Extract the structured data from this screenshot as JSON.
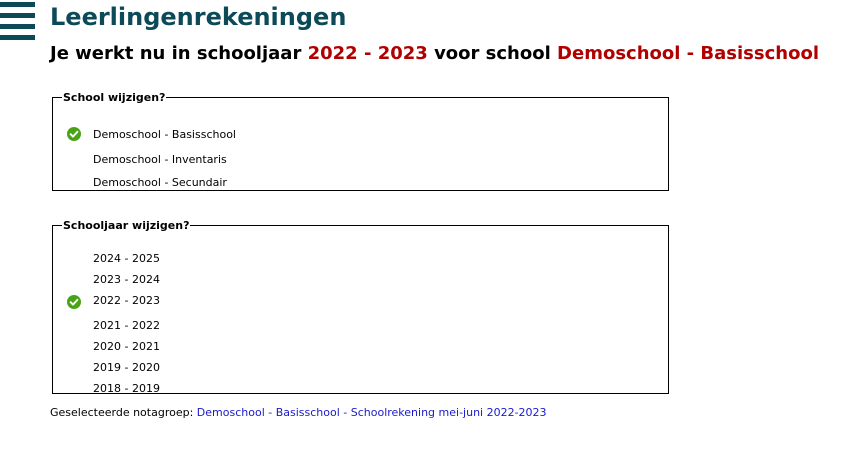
{
  "header": {
    "title": "Leerlingenrekeningen",
    "context_prefix": "Je werkt nu in schooljaar ",
    "context_year": "2022 - 2023",
    "context_middle": " voor school ",
    "context_school": "Demoschool - Basisschool",
    "accent_color": "#b00000",
    "brand_color": "#0d4a57"
  },
  "menu": {
    "icon": "hamburger-menu-icon"
  },
  "school_section": {
    "legend": "School wijzigen?",
    "options": [
      {
        "label": "Demoschool - Basisschool",
        "selected": true
      },
      {
        "label": "Demoschool - Inventaris",
        "selected": false
      },
      {
        "label": "Demoschool - Secundair",
        "selected": false
      }
    ]
  },
  "year_section": {
    "legend": "Schooljaar wijzigen?",
    "options": [
      {
        "label": "2024 - 2025",
        "selected": false
      },
      {
        "label": "2023 - 2024",
        "selected": false
      },
      {
        "label": "2022 - 2023",
        "selected": true
      },
      {
        "label": "2021 - 2022",
        "selected": false
      },
      {
        "label": "2020 - 2021",
        "selected": false
      },
      {
        "label": "2019 - 2020",
        "selected": false
      },
      {
        "label": "2018 - 2019",
        "selected": false
      }
    ]
  },
  "footer": {
    "label": "Geselecteerde notagroep: ",
    "link_text": "Demoschool - Basisschool - Schoolrekening mei-juni 2022-2023"
  },
  "check_icon": {
    "name": "check-circle-icon",
    "color": "#4aa317"
  }
}
